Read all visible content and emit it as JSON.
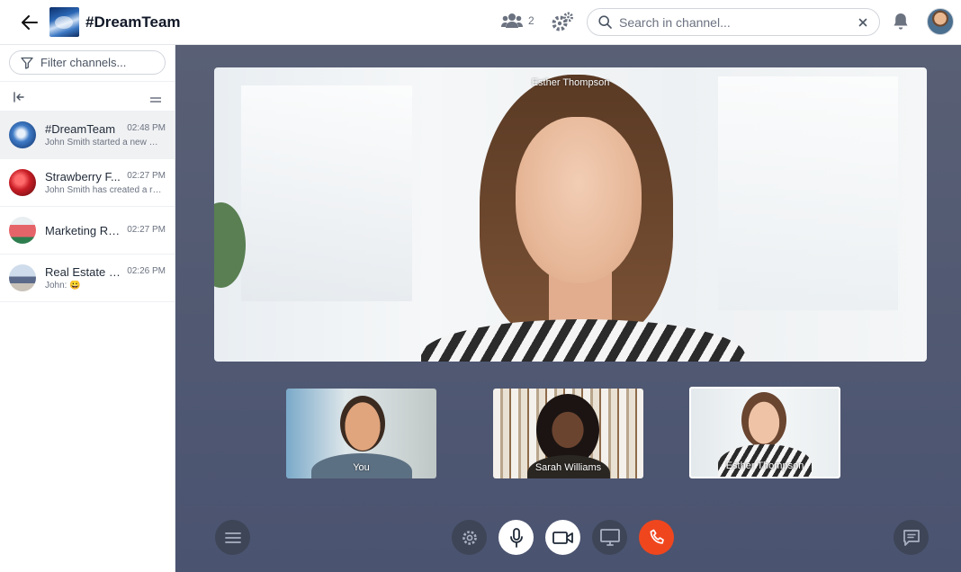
{
  "header": {
    "channel_title": "#DreamTeam",
    "members_count": "2",
    "search_placeholder": "Search in channel..."
  },
  "sidebar": {
    "filter_placeholder": "Filter channels...",
    "channels": [
      {
        "name": "#DreamTeam",
        "time": "02:48 PM",
        "preview": "John Smith started a new m...",
        "active": true
      },
      {
        "name": "Strawberry F...",
        "time": "02:27 PM",
        "preview": "John Smith has created a re...",
        "active": false
      },
      {
        "name": "Marketing Ro...",
        "time": "02:27 PM",
        "preview": "",
        "active": false
      },
      {
        "name": "Real Estate U...",
        "time": "02:26 PM",
        "preview": "John: 😀",
        "active": false
      }
    ]
  },
  "call": {
    "main_speaker": "Esther Thompson",
    "participants": [
      {
        "label": "You"
      },
      {
        "label": "Sarah Williams"
      },
      {
        "label": "Esther Thompson",
        "selected": true
      }
    ]
  },
  "colors": {
    "call_background": "#4e5670",
    "control_dark": "#3d4557",
    "hangup_red": "#f0461e"
  },
  "icons": {
    "back": "arrow-left-icon",
    "members": "users-icon",
    "settings": "gears-icon",
    "search": "search-icon",
    "clear": "close-icon",
    "notifications": "bell-icon",
    "filter": "filter-icon",
    "menu": "hamburger-icon",
    "microphone": "microphone-icon",
    "camera": "video-camera-icon",
    "screen": "monitor-icon",
    "hangup": "phone-icon",
    "chat": "chat-bubble-icon"
  }
}
